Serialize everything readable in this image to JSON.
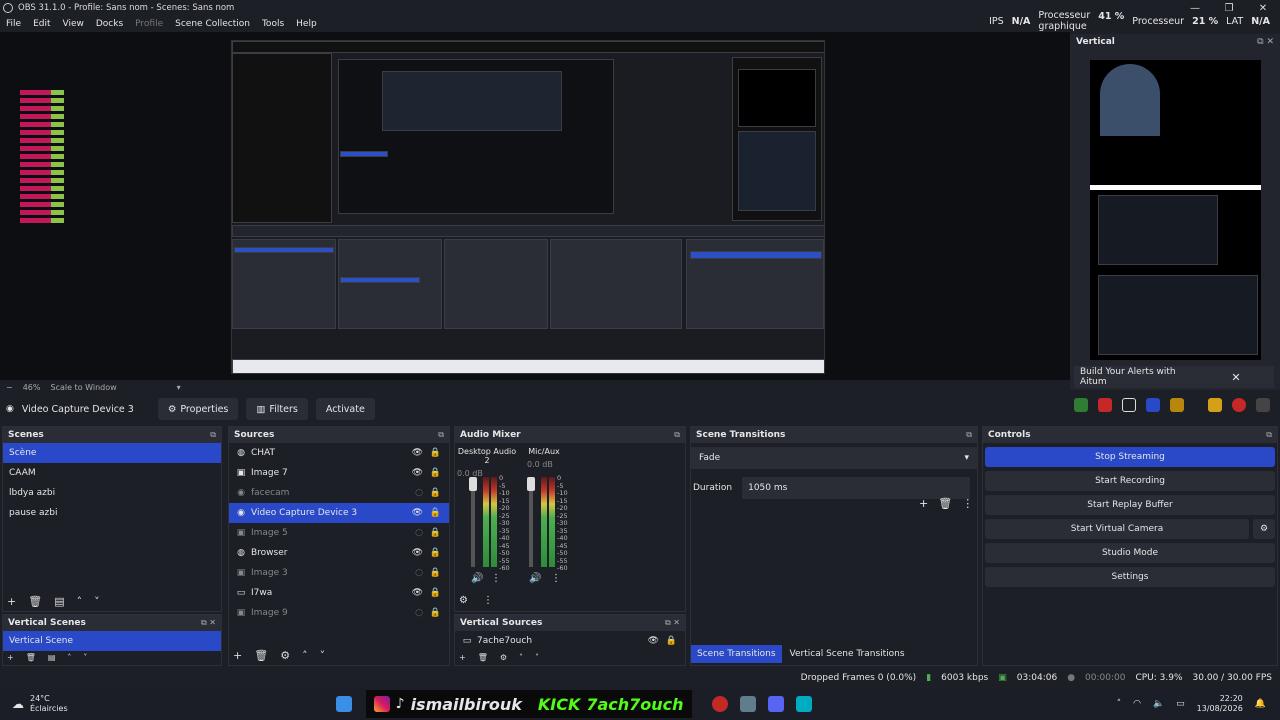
{
  "window": {
    "title": "OBS 31.1.0 - Profile: Sans nom - Scenes: Sans nom"
  },
  "menu": [
    "File",
    "Edit",
    "View",
    "Docks",
    "Profile",
    "Scene Collection",
    "Tools",
    "Help"
  ],
  "stats": {
    "fps_label": "IPS",
    "fps_value": "N/A",
    "gpu_label_1": "Processeur",
    "gpu_label_2": "graphique",
    "gpu_value": "41 %",
    "cpu_label": "Processeur",
    "cpu_value": "21 %",
    "lat_label": "LAT",
    "lat_value": "N/A"
  },
  "zoom": {
    "minus": "−",
    "value": "46%",
    "mode": "Scale to Window"
  },
  "vertical_panel": {
    "title": "Vertical",
    "alerts_label": "Build Your Alerts with Aitum",
    "close": "✕"
  },
  "source_bar": {
    "name": "Video Capture Device 3",
    "properties": "Properties",
    "filters": "Filters",
    "activate": "Activate"
  },
  "scenes": {
    "title": "Scenes",
    "items": [
      "Scène",
      "CAAM",
      "lbdya azbi",
      "pause azbi"
    ]
  },
  "vertical_scenes": {
    "title": "Vertical Scenes",
    "items": [
      "Vertical Scene"
    ]
  },
  "sources": {
    "title": "Sources",
    "items": [
      {
        "name": "CHAT",
        "icon": "globe-icon",
        "dim": false,
        "sel": false
      },
      {
        "name": "Image 7",
        "icon": "image-icon",
        "dim": false,
        "sel": false
      },
      {
        "name": "facecam",
        "icon": "camera-icon",
        "dim": true,
        "sel": false
      },
      {
        "name": "Video Capture Device 3",
        "icon": "camera-icon",
        "dim": false,
        "sel": true
      },
      {
        "name": "Image 5",
        "icon": "image-icon",
        "dim": true,
        "sel": false
      },
      {
        "name": "Browser",
        "icon": "globe-icon",
        "dim": false,
        "sel": false
      },
      {
        "name": "Image 3",
        "icon": "image-icon",
        "dim": true,
        "sel": false
      },
      {
        "name": "I7wa",
        "icon": "window-icon",
        "dim": false,
        "sel": false
      },
      {
        "name": "Image 9",
        "icon": "image-icon",
        "dim": true,
        "sel": false
      }
    ]
  },
  "mixer": {
    "title": "Audio Mixer",
    "channels": [
      {
        "name": "Desktop Audio 2",
        "db": "0.0 dB"
      },
      {
        "name": "Mic/Aux",
        "db": "0.0 dB"
      }
    ],
    "scale": [
      "0",
      "-5",
      "-10",
      "-15",
      "-20",
      "-25",
      "-30",
      "-35",
      "-40",
      "-45",
      "-50",
      "-55",
      "-60"
    ]
  },
  "vertical_sources": {
    "title": "Vertical Sources",
    "items": [
      "7ache7ouch"
    ]
  },
  "transitions": {
    "title": "Scene Transitions",
    "value": "Fade",
    "duration_label": "Duration",
    "duration_value": "1050 ms",
    "tab1": "Scene Transitions",
    "tab2": "Vertical Scene Transitions"
  },
  "controls": {
    "title": "Controls",
    "buttons": [
      "Stop Streaming",
      "Start Recording",
      "Start Replay Buffer",
      "Start Virtual Camera",
      "Studio Mode",
      "Settings"
    ]
  },
  "status": {
    "dropped": "Dropped Frames 0 (0.0%)",
    "kbps": "6003 kbps",
    "stream_time": "03:04:06",
    "rec_time": "00:00:00",
    "cpu": "CPU: 3.9%",
    "fps": "30.00 / 30.00 FPS"
  },
  "taskbar": {
    "temp": "24°C",
    "weather": "Éclaircies",
    "banner_name": "ismailbirouk",
    "banner_kick": "KICK",
    "banner_kick_name": "7ach7ouch",
    "time": "22:20",
    "date": "13/08/2026"
  },
  "colors": {
    "accent": "#2a49c8",
    "bg": "#1d1f26",
    "panel": "#2a2d36"
  }
}
